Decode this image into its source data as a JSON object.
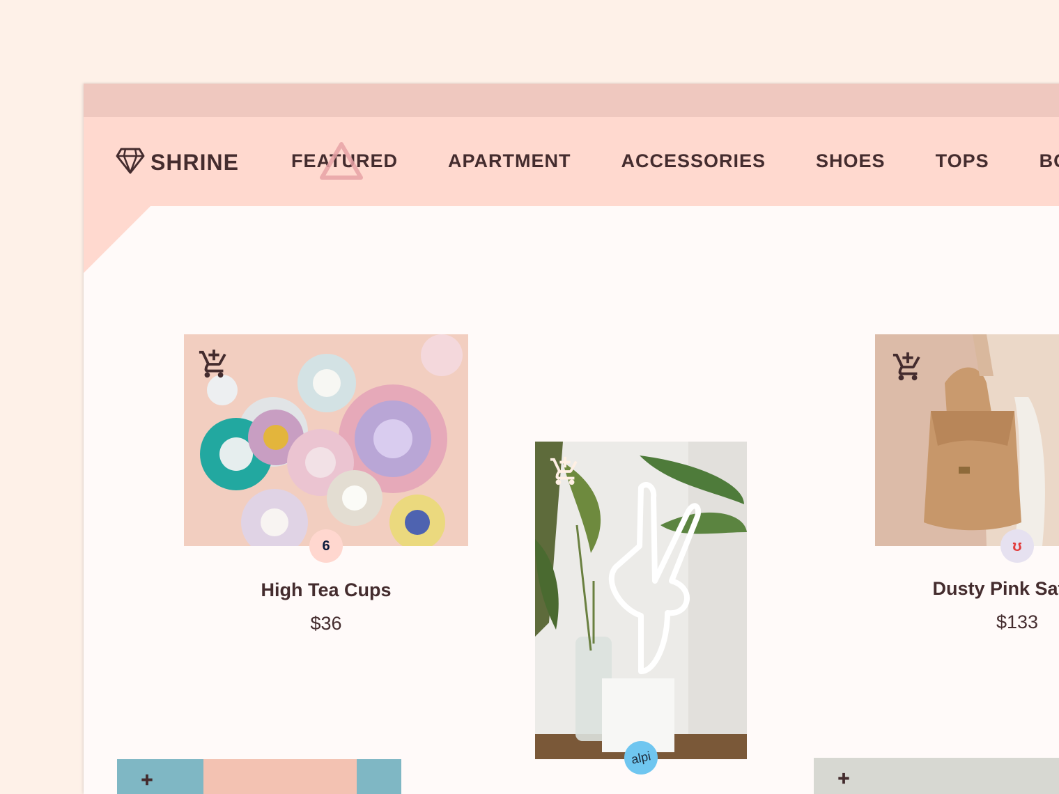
{
  "app": {
    "brand": "SHRINE"
  },
  "nav": {
    "tabs": [
      {
        "label": "FEATURED",
        "selected": true
      },
      {
        "label": "APARTMENT"
      },
      {
        "label": "ACCESSORIES"
      },
      {
        "label": "SHOES"
      },
      {
        "label": "TOPS"
      },
      {
        "label": "BOTTOMS"
      }
    ]
  },
  "products": [
    {
      "name": "High Tea Cups",
      "price": "$36",
      "vendor_icon": "6",
      "icon": "add-to-cart-icon"
    },
    {
      "name": "",
      "price": "",
      "vendor_icon": "alpi",
      "icon": "add-to-cart-icon"
    },
    {
      "name": "Dusty Pink Satchel",
      "price": "$133",
      "vendor_icon": "ʊ",
      "icon": "add-to-cart-icon"
    }
  ],
  "colors": {
    "page_bg": "#FEF1E8",
    "titlebar": "#EFC8BF",
    "header": "#FFD9CF",
    "content_bg": "#FFFAF9",
    "text": "#442C2E",
    "accent_marker": "#E7A2A6"
  }
}
